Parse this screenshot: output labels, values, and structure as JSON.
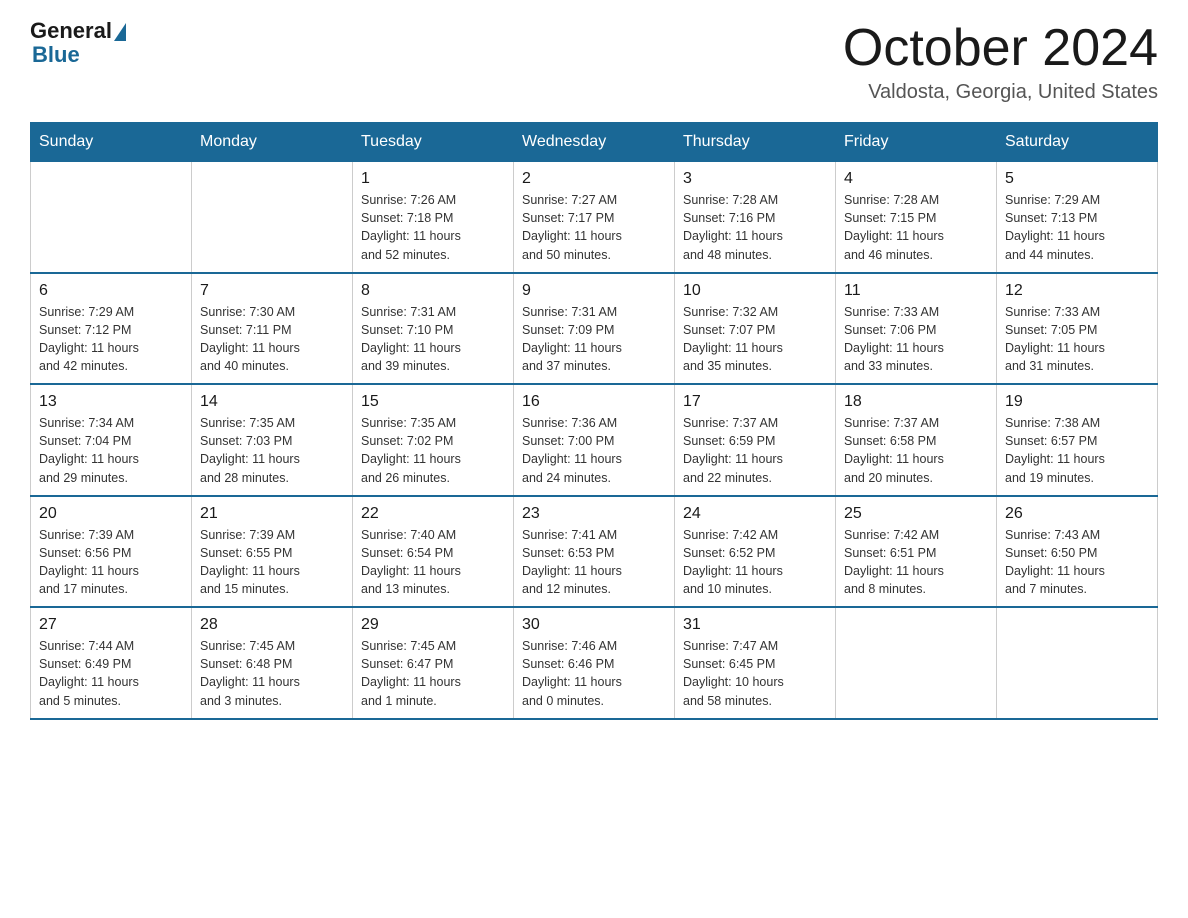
{
  "logo": {
    "general": "General",
    "blue": "Blue"
  },
  "title": {
    "month": "October 2024",
    "location": "Valdosta, Georgia, United States"
  },
  "weekdays": [
    "Sunday",
    "Monday",
    "Tuesday",
    "Wednesday",
    "Thursday",
    "Friday",
    "Saturday"
  ],
  "weeks": [
    [
      {
        "num": "",
        "info": ""
      },
      {
        "num": "",
        "info": ""
      },
      {
        "num": "1",
        "info": "Sunrise: 7:26 AM\nSunset: 7:18 PM\nDaylight: 11 hours\nand 52 minutes."
      },
      {
        "num": "2",
        "info": "Sunrise: 7:27 AM\nSunset: 7:17 PM\nDaylight: 11 hours\nand 50 minutes."
      },
      {
        "num": "3",
        "info": "Sunrise: 7:28 AM\nSunset: 7:16 PM\nDaylight: 11 hours\nand 48 minutes."
      },
      {
        "num": "4",
        "info": "Sunrise: 7:28 AM\nSunset: 7:15 PM\nDaylight: 11 hours\nand 46 minutes."
      },
      {
        "num": "5",
        "info": "Sunrise: 7:29 AM\nSunset: 7:13 PM\nDaylight: 11 hours\nand 44 minutes."
      }
    ],
    [
      {
        "num": "6",
        "info": "Sunrise: 7:29 AM\nSunset: 7:12 PM\nDaylight: 11 hours\nand 42 minutes."
      },
      {
        "num": "7",
        "info": "Sunrise: 7:30 AM\nSunset: 7:11 PM\nDaylight: 11 hours\nand 40 minutes."
      },
      {
        "num": "8",
        "info": "Sunrise: 7:31 AM\nSunset: 7:10 PM\nDaylight: 11 hours\nand 39 minutes."
      },
      {
        "num": "9",
        "info": "Sunrise: 7:31 AM\nSunset: 7:09 PM\nDaylight: 11 hours\nand 37 minutes."
      },
      {
        "num": "10",
        "info": "Sunrise: 7:32 AM\nSunset: 7:07 PM\nDaylight: 11 hours\nand 35 minutes."
      },
      {
        "num": "11",
        "info": "Sunrise: 7:33 AM\nSunset: 7:06 PM\nDaylight: 11 hours\nand 33 minutes."
      },
      {
        "num": "12",
        "info": "Sunrise: 7:33 AM\nSunset: 7:05 PM\nDaylight: 11 hours\nand 31 minutes."
      }
    ],
    [
      {
        "num": "13",
        "info": "Sunrise: 7:34 AM\nSunset: 7:04 PM\nDaylight: 11 hours\nand 29 minutes."
      },
      {
        "num": "14",
        "info": "Sunrise: 7:35 AM\nSunset: 7:03 PM\nDaylight: 11 hours\nand 28 minutes."
      },
      {
        "num": "15",
        "info": "Sunrise: 7:35 AM\nSunset: 7:02 PM\nDaylight: 11 hours\nand 26 minutes."
      },
      {
        "num": "16",
        "info": "Sunrise: 7:36 AM\nSunset: 7:00 PM\nDaylight: 11 hours\nand 24 minutes."
      },
      {
        "num": "17",
        "info": "Sunrise: 7:37 AM\nSunset: 6:59 PM\nDaylight: 11 hours\nand 22 minutes."
      },
      {
        "num": "18",
        "info": "Sunrise: 7:37 AM\nSunset: 6:58 PM\nDaylight: 11 hours\nand 20 minutes."
      },
      {
        "num": "19",
        "info": "Sunrise: 7:38 AM\nSunset: 6:57 PM\nDaylight: 11 hours\nand 19 minutes."
      }
    ],
    [
      {
        "num": "20",
        "info": "Sunrise: 7:39 AM\nSunset: 6:56 PM\nDaylight: 11 hours\nand 17 minutes."
      },
      {
        "num": "21",
        "info": "Sunrise: 7:39 AM\nSunset: 6:55 PM\nDaylight: 11 hours\nand 15 minutes."
      },
      {
        "num": "22",
        "info": "Sunrise: 7:40 AM\nSunset: 6:54 PM\nDaylight: 11 hours\nand 13 minutes."
      },
      {
        "num": "23",
        "info": "Sunrise: 7:41 AM\nSunset: 6:53 PM\nDaylight: 11 hours\nand 12 minutes."
      },
      {
        "num": "24",
        "info": "Sunrise: 7:42 AM\nSunset: 6:52 PM\nDaylight: 11 hours\nand 10 minutes."
      },
      {
        "num": "25",
        "info": "Sunrise: 7:42 AM\nSunset: 6:51 PM\nDaylight: 11 hours\nand 8 minutes."
      },
      {
        "num": "26",
        "info": "Sunrise: 7:43 AM\nSunset: 6:50 PM\nDaylight: 11 hours\nand 7 minutes."
      }
    ],
    [
      {
        "num": "27",
        "info": "Sunrise: 7:44 AM\nSunset: 6:49 PM\nDaylight: 11 hours\nand 5 minutes."
      },
      {
        "num": "28",
        "info": "Sunrise: 7:45 AM\nSunset: 6:48 PM\nDaylight: 11 hours\nand 3 minutes."
      },
      {
        "num": "29",
        "info": "Sunrise: 7:45 AM\nSunset: 6:47 PM\nDaylight: 11 hours\nand 1 minute."
      },
      {
        "num": "30",
        "info": "Sunrise: 7:46 AM\nSunset: 6:46 PM\nDaylight: 11 hours\nand 0 minutes."
      },
      {
        "num": "31",
        "info": "Sunrise: 7:47 AM\nSunset: 6:45 PM\nDaylight: 10 hours\nand 58 minutes."
      },
      {
        "num": "",
        "info": ""
      },
      {
        "num": "",
        "info": ""
      }
    ]
  ]
}
